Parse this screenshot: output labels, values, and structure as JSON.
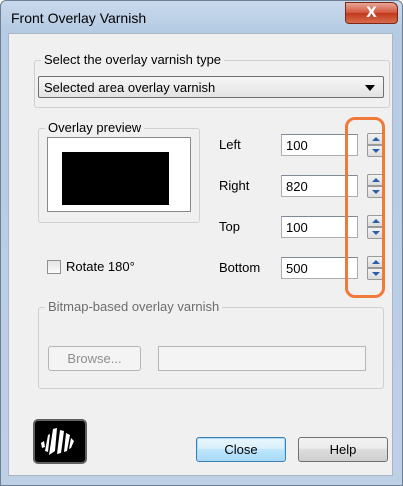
{
  "window": {
    "title": "Front Overlay Varnish",
    "close_glyph": "X"
  },
  "varnish_type": {
    "group_label": "Select the overlay varnish type",
    "selected": "Selected area overlay varnish"
  },
  "preview": {
    "group_label": "Overlay preview"
  },
  "fields": [
    {
      "label": "Left",
      "value": "100"
    },
    {
      "label": "Right",
      "value": "820"
    },
    {
      "label": "Top",
      "value": "100"
    },
    {
      "label": "Bottom",
      "value": "500"
    }
  ],
  "rotate": {
    "label": "Rotate 180°",
    "checked": false
  },
  "bitmap": {
    "group_label": "Bitmap-based overlay varnish",
    "browse_label": "Browse...",
    "path_value": ""
  },
  "buttons": {
    "close_label": "Close",
    "help_label": "Help"
  },
  "logo_icon": "zebra-logo-icon",
  "highlight_color": "#f07a3a"
}
